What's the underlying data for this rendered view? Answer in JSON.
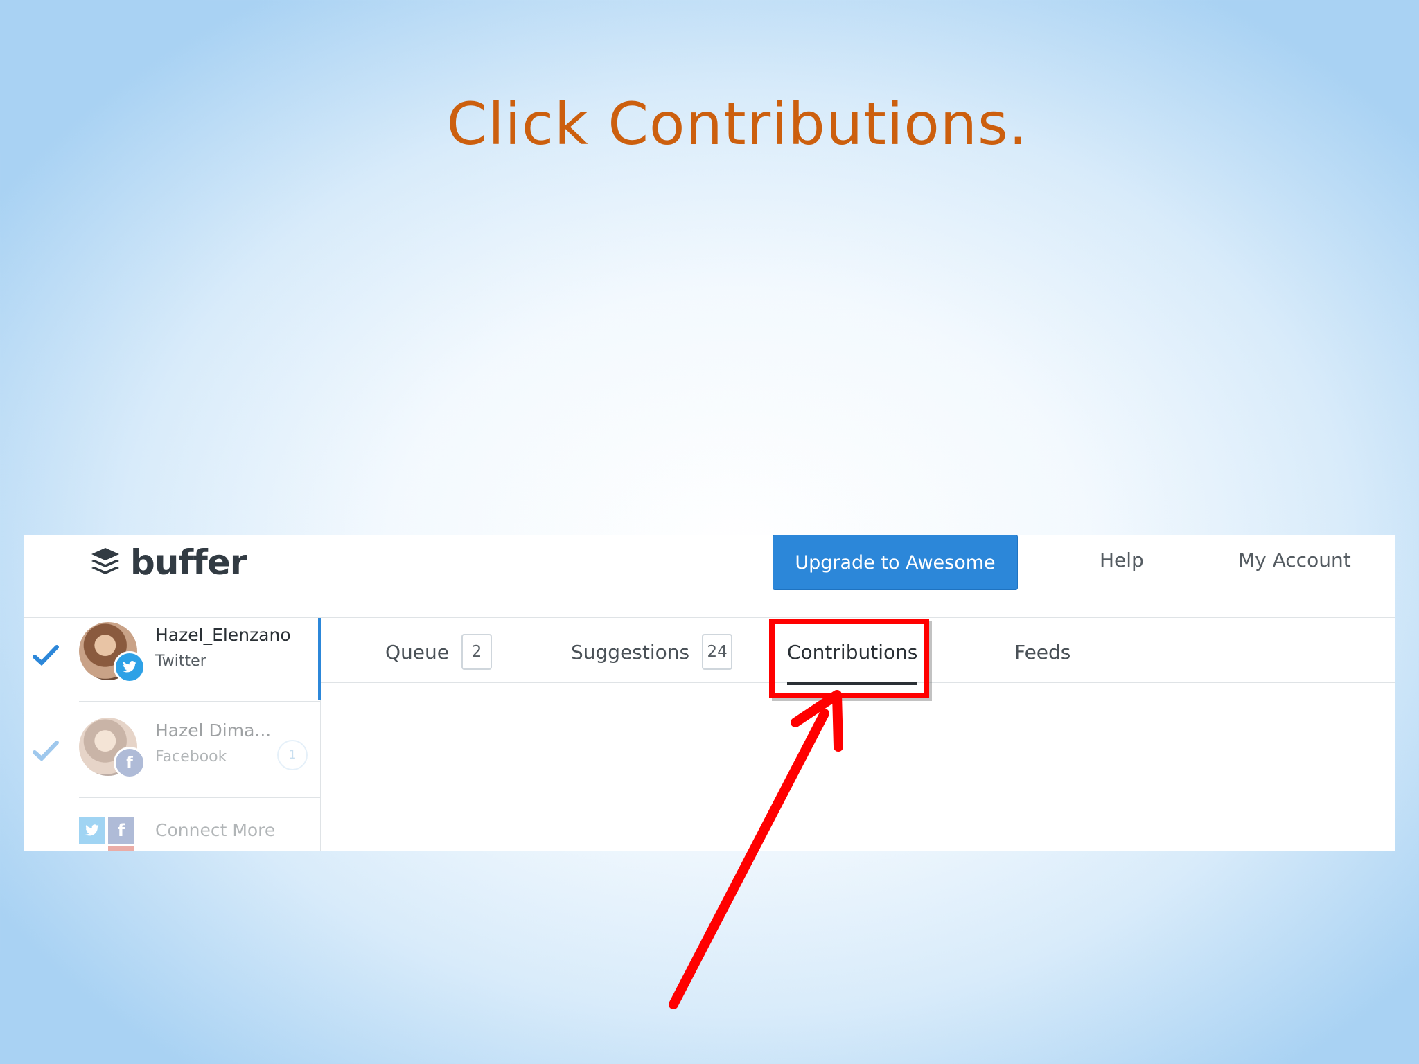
{
  "slide": {
    "title": "Click Contributions.",
    "accent_color": "#cc5f0e",
    "callout_color": "#ff0000"
  },
  "app": {
    "logo_text": "buffer",
    "upgrade_button": "Upgrade to Awesome",
    "nav": {
      "help": "Help",
      "my_account": "My Account"
    },
    "brand_color": "#2c87d9"
  },
  "sidebar": {
    "profiles": [
      {
        "name": "Hazel_Elenzano",
        "network": "Twitter",
        "icon": "twitter-icon",
        "selected": true
      },
      {
        "name": "Hazel Dima...",
        "network": "Facebook",
        "icon": "facebook-icon",
        "selected": false,
        "badge": "1"
      }
    ],
    "connect_more": "Connect More"
  },
  "tabs": [
    {
      "label": "Queue",
      "count": "2"
    },
    {
      "label": "Suggestions",
      "count": "24"
    },
    {
      "label": "Contributions",
      "active": true
    },
    {
      "label": "Feeds"
    }
  ]
}
